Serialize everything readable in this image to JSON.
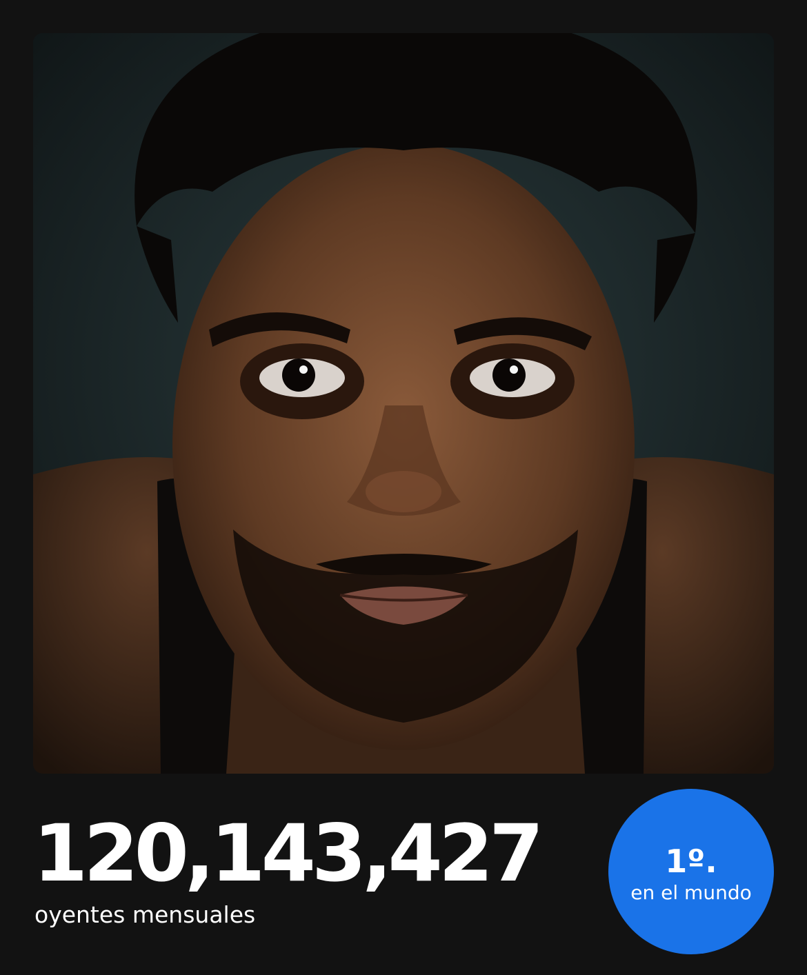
{
  "artist_image": {
    "icon": "artist-portrait-photo"
  },
  "stats": {
    "monthly_listeners": "120,143,427",
    "monthly_listeners_label": "oyentes mensuales"
  },
  "rank": {
    "value": "1º.",
    "label": "en el mundo",
    "color": "#1a73e8"
  },
  "colors": {
    "background": "#121212",
    "text": "#ffffff",
    "accent": "#1a73e8"
  }
}
